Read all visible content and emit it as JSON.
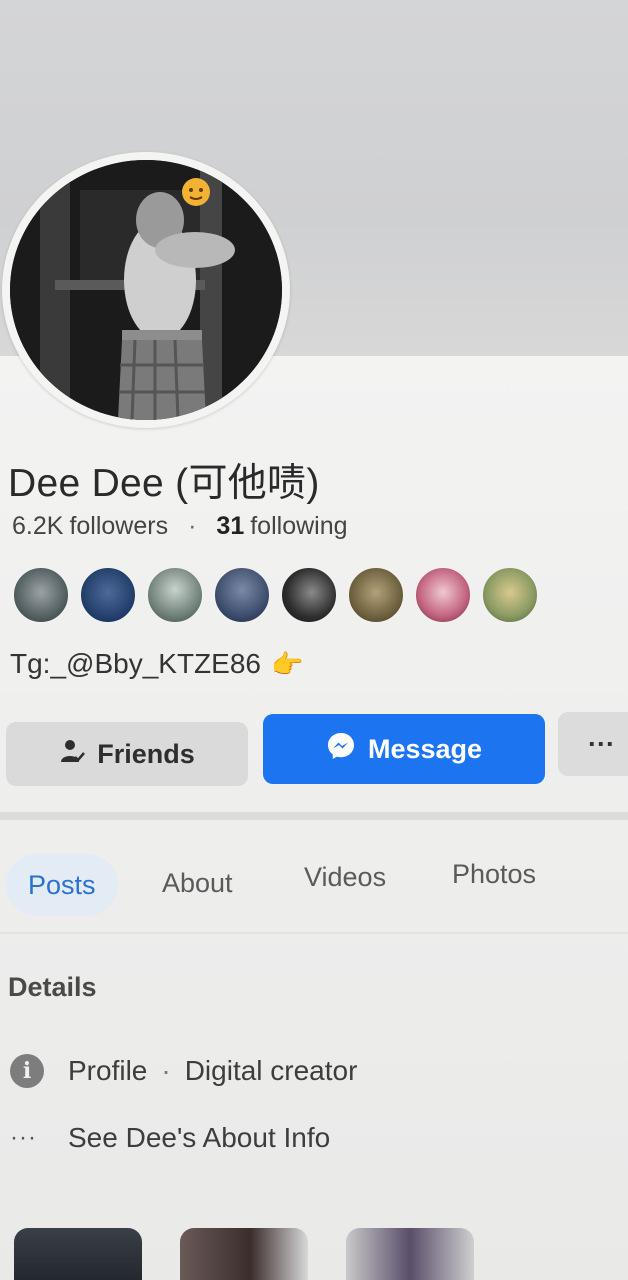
{
  "profile": {
    "name": "Dee Dee (可他啧)",
    "followers_count": "6.2K",
    "followers_label": "followers",
    "following_count": "31",
    "following_label": "following",
    "bio": "Tg:_@Bby_KTZE86",
    "bio_emoji": "👉"
  },
  "friends_preview": {
    "count": 8,
    "colors": [
      "#5b6a6e",
      "#1f3a66",
      "#6b7d74",
      "#3a4a6a",
      "#2d2d2d",
      "#6a5d3c",
      "#c2627f",
      "#8a9a62"
    ]
  },
  "actions": {
    "friends_label": "Friends",
    "message_label": "Message",
    "more_label": "···"
  },
  "tabs": [
    {
      "label": "Posts",
      "active": true
    },
    {
      "label": "About",
      "active": false
    },
    {
      "label": "Videos",
      "active": false
    },
    {
      "label": "Photos",
      "active": false
    }
  ],
  "details": {
    "title": "Details",
    "profile_label": "Profile",
    "profile_category": "Digital creator",
    "about_link": "See Dee's About Info"
  },
  "colors": {
    "accent": "#1c74f0",
    "tab_active_text": "#2a72d0",
    "tab_active_bg": "#e3ebf4"
  },
  "icons": {
    "friends": "person-check-icon",
    "message": "messenger-icon",
    "info": "info-icon",
    "more": "ellipsis-icon"
  }
}
